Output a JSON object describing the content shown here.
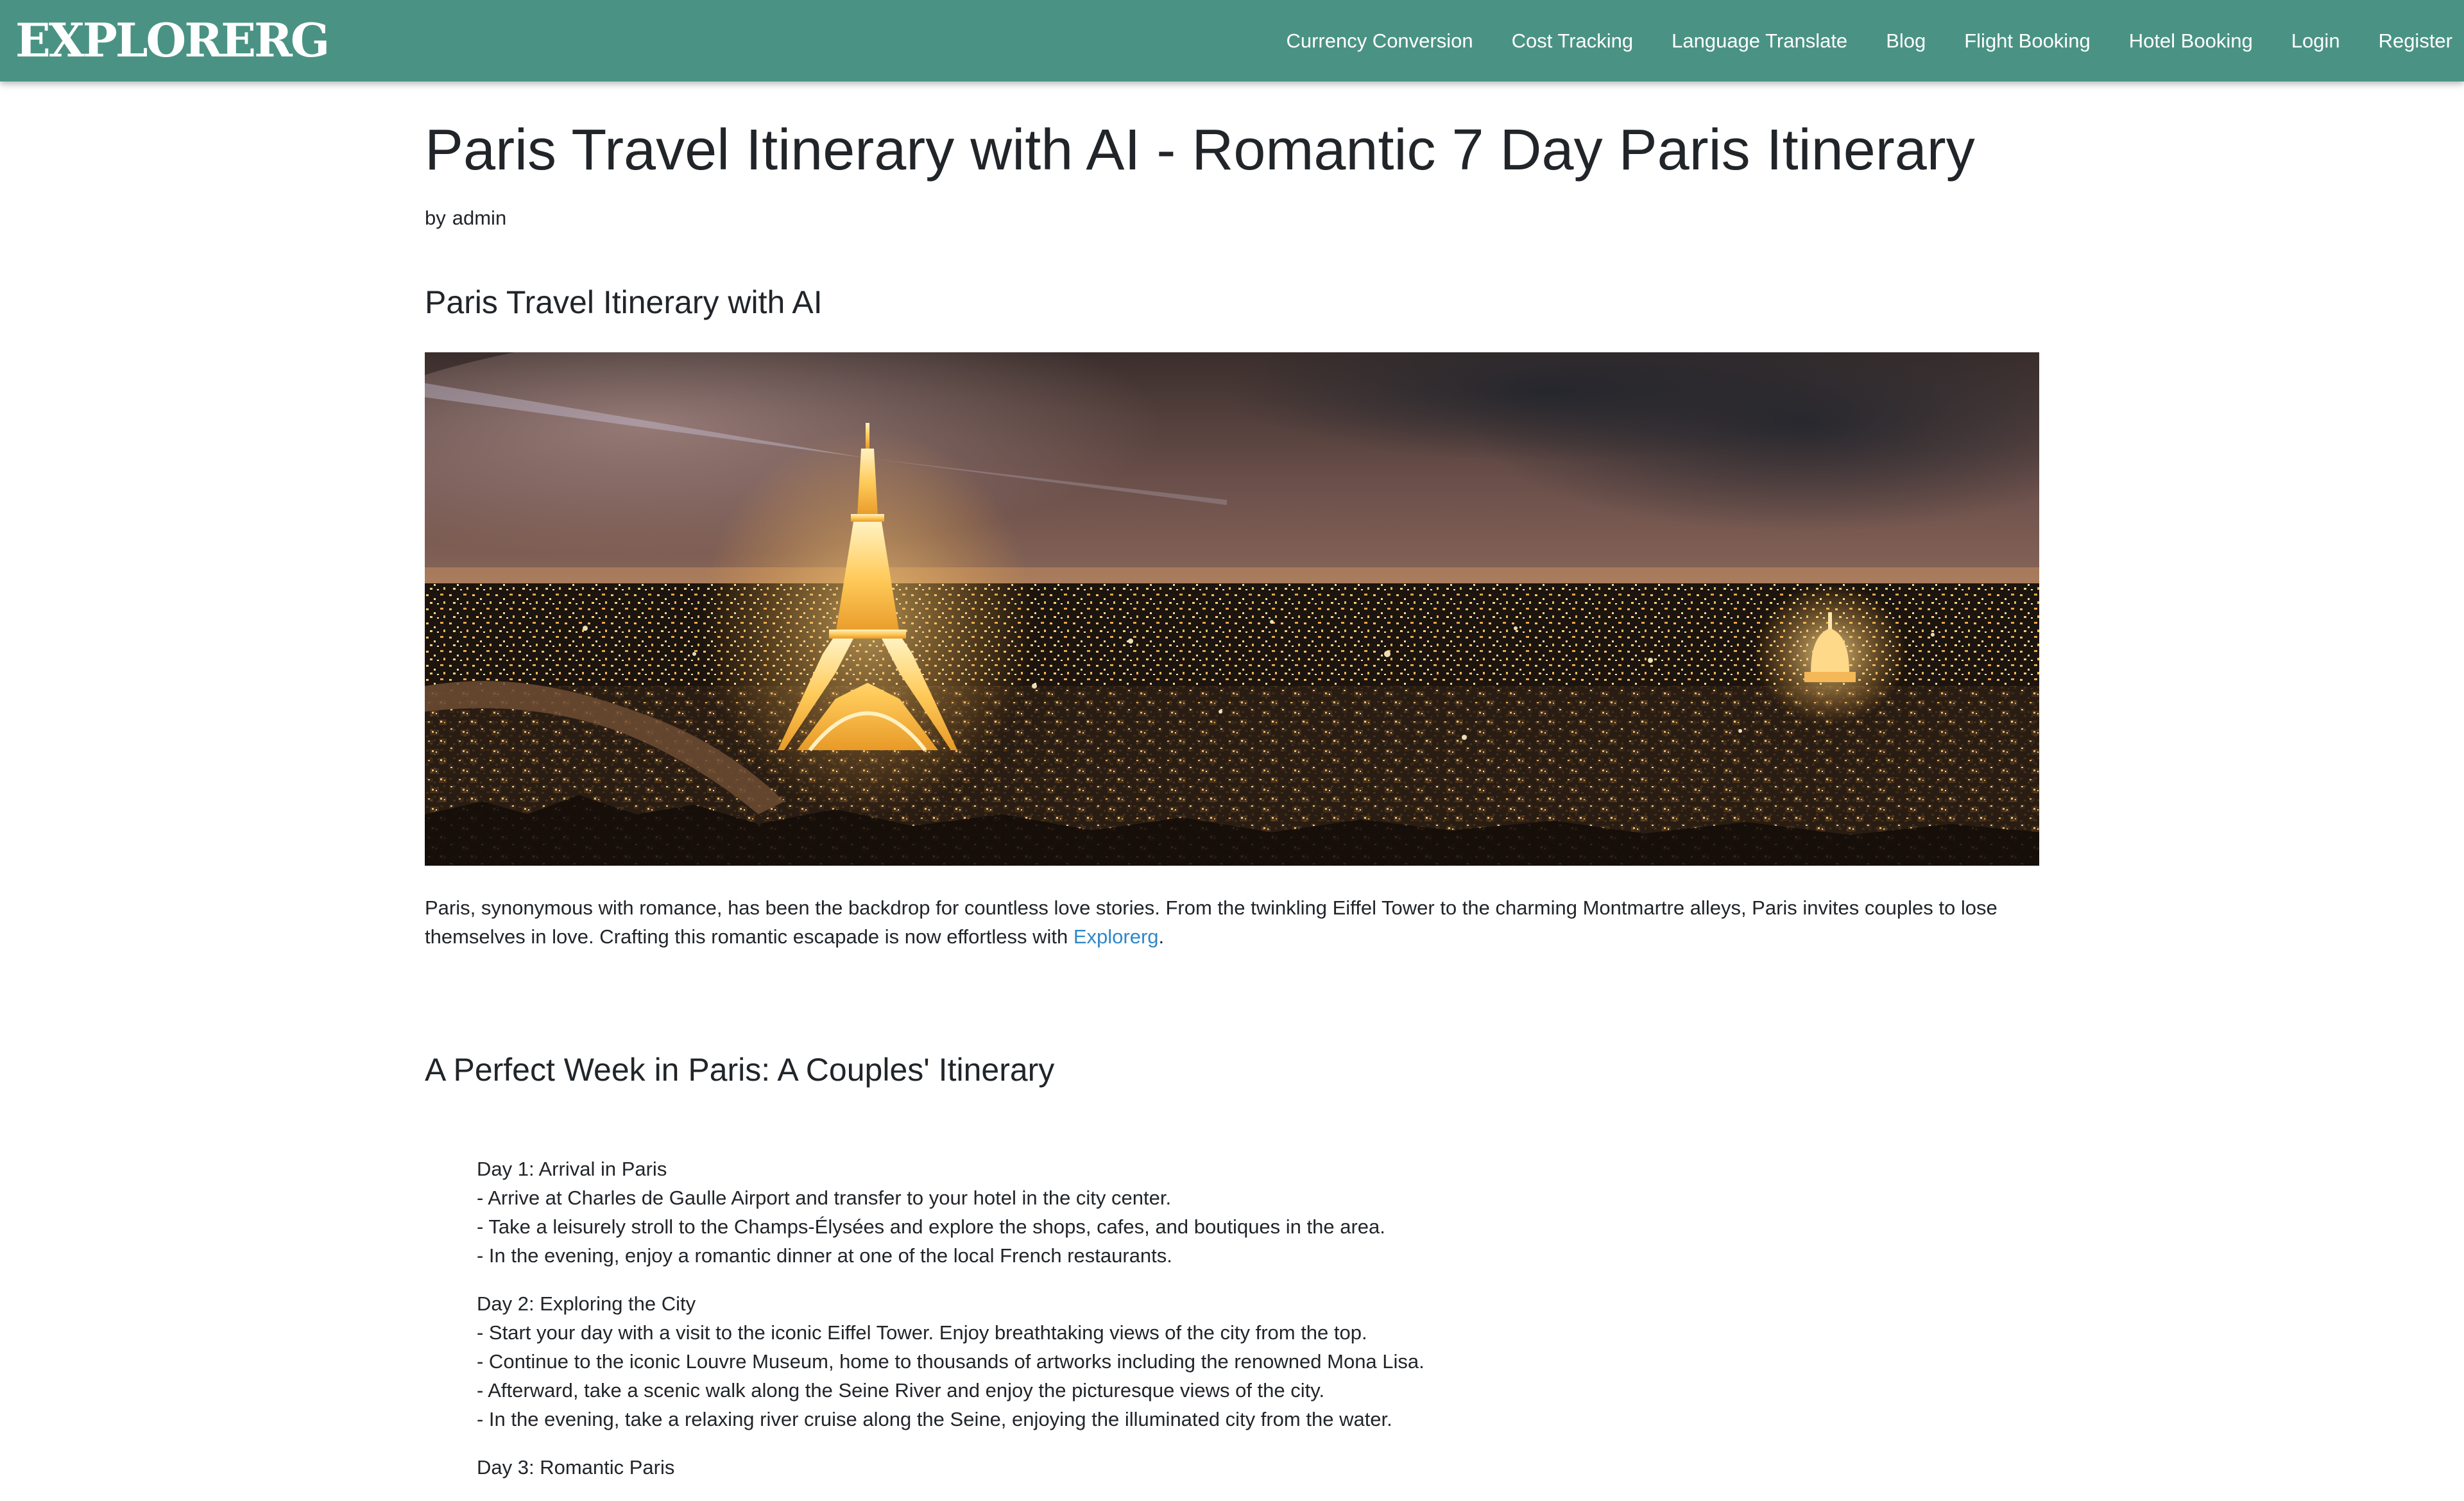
{
  "brand": "EXPLORERG",
  "nav": [
    "Currency Conversion",
    "Cost Tracking",
    "Language Translate",
    "Blog",
    "Flight Booking",
    "Hotel Booking",
    "Login",
    "Register"
  ],
  "article": {
    "title": "Paris Travel Itinerary with AI - Romantic 7 Day Paris Itinerary",
    "byline_prefix": "by",
    "author": "admin",
    "section_title": "Paris Travel Itinerary with AI",
    "intro_text": "Paris, synonymous with romance, has been the backdrop for countless love stories. From the twinkling Eiffel Tower to the charming Montmartre alleys, Paris invites couples to lose themselves in love. Crafting this romantic escapade is now effortless with",
    "intro_link": "Explorerg",
    "intro_end": ".",
    "week_title": "A Perfect Week in Paris: A Couples' Itinerary",
    "days": [
      {
        "title": "Day 1: Arrival in Paris",
        "items": [
          "- Arrive at Charles de Gaulle Airport and transfer to your hotel in the city center.",
          "- Take a leisurely stroll to the Champs-Élysées and explore the shops, cafes, and boutiques in the area.",
          "- In the evening, enjoy a romantic dinner at one of the local French restaurants."
        ]
      },
      {
        "title": "Day 2: Exploring the City",
        "items": [
          "- Start your day with a visit to the iconic Eiffel Tower. Enjoy breathtaking views of the city from the top.",
          "- Continue to the iconic Louvre Museum, home to thousands of artworks including the renowned Mona Lisa.",
          "- Afterward, take a scenic walk along the Seine River and enjoy the picturesque views of the city.",
          "- In the evening, take a relaxing river cruise along the Seine, enjoying the illuminated city from the water."
        ]
      },
      {
        "title": "Day 3: Romantic Paris",
        "items": []
      }
    ]
  },
  "colors": {
    "navbar": "#4a9384",
    "link": "#2f87c9",
    "text": "#212529"
  }
}
